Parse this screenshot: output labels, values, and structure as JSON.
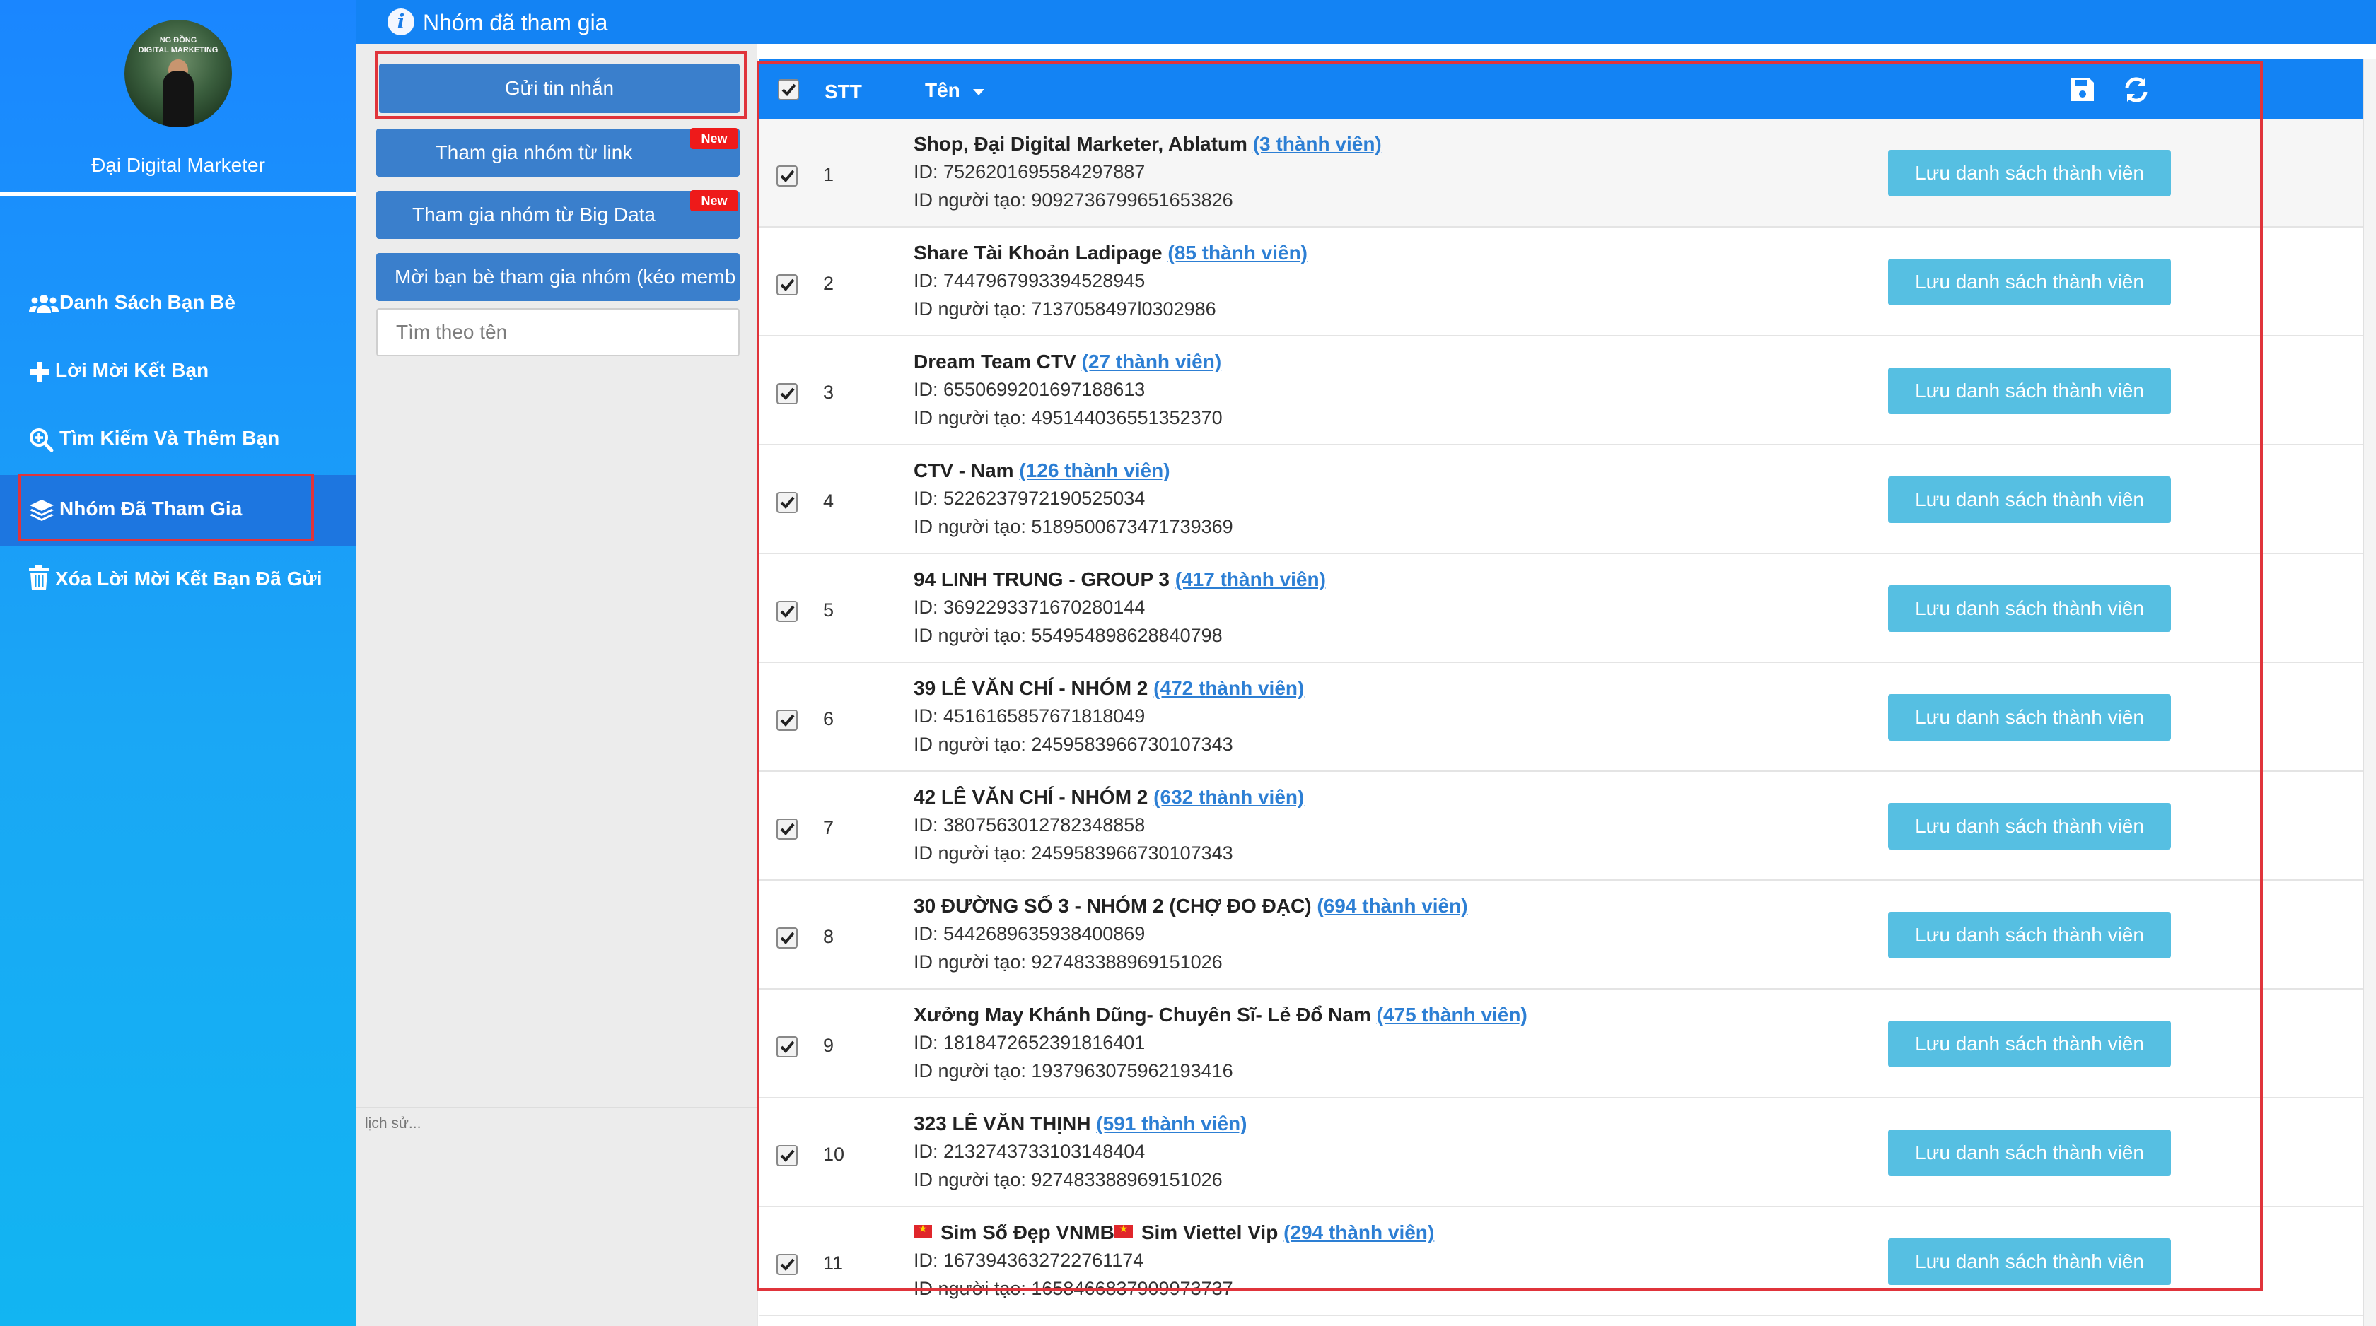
{
  "sidebar": {
    "profile_name": "Đại Digital Marketer",
    "avatar_banner": "NG ĐỒNG\nDIGITAL MARKETING",
    "nav": [
      {
        "label": "Danh Sách Bạn Bè",
        "icon": "users-icon"
      },
      {
        "label": "Lời Mời Kết Bạn",
        "icon": "plus-icon"
      },
      {
        "label": "Tìm Kiếm Và Thêm Bạn",
        "icon": "search-plus-icon"
      },
      {
        "label": "Nhóm Đã Tham Gia",
        "icon": "layers-icon",
        "active": true
      },
      {
        "label": "Xóa Lời Mời Kết Bạn Đã Gửi",
        "icon": "trash-icon"
      }
    ]
  },
  "header": {
    "title": "Nhóm đã tham gia",
    "icon": "info-icon"
  },
  "panel": {
    "send_message": "Gửi tin nhắn",
    "join_from_link": "Tham gia nhóm từ link",
    "join_from_bigdata": "Tham gia nhóm từ Big Data",
    "new_badge": "New",
    "invite_friends": "Mời bạn bè tham gia nhóm (kéo memb",
    "search_placeholder": "Tìm theo tên",
    "history": "lịch sử..."
  },
  "table": {
    "col_stt": "STT",
    "col_name": "Tên",
    "id_prefix": "ID: ",
    "creator_prefix": "ID người tạo: ",
    "save_members_label": "Lưu danh sách thành viên",
    "colors": {
      "header": "#1383f4",
      "save_button": "#56bfe2",
      "link": "#2d7fd4"
    },
    "rows": [
      {
        "stt": "1",
        "name": "Shop, Đại Digital Marketer, Ablatum",
        "members": "(3 thành viên)",
        "id": "7526201695584297887",
        "creator_id": "9092736799651653826"
      },
      {
        "stt": "2",
        "name": "Share Tài Khoản Ladipage",
        "members": "(85 thành viên)",
        "id": "7447967993394528945",
        "creator_id": "7137058497l0302986"
      },
      {
        "stt": "3",
        "name": "Dream Team CTV",
        "members": "(27 thành viên)",
        "id": "6550699201697188613",
        "creator_id": "4951440365513523​70"
      },
      {
        "stt": "4",
        "name": "CTV - Nam",
        "members": "(126 thành viên)",
        "id": "5226237972190525034",
        "creator_id": "5189500673471739369"
      },
      {
        "stt": "5",
        "name": "94 LINH TRUNG - GROUP 3",
        "members": "(417 thành viên)",
        "id": "3692293371670280144",
        "creator_id": "554954898628840798"
      },
      {
        "stt": "6",
        "name": "39 LÊ VĂN CHÍ - NHÓM 2",
        "members": "(472 thành viên)",
        "id": "4516165857671818049",
        "creator_id": "2459583966730107343"
      },
      {
        "stt": "7",
        "name": "42 LÊ VĂN CHÍ - NHÓM 2",
        "members": "(632 thành viên)",
        "id": "3807563012782348858",
        "creator_id": "2459583966730107343"
      },
      {
        "stt": "8",
        "name": "30 ĐƯỜNG SỐ 3 - NHÓM 2 (CHỢ ĐO ĐẠC)",
        "members": "(694 thành viên)",
        "id": "5442689635938400869",
        "creator_id": "9274833889691510​26"
      },
      {
        "stt": "9",
        "name": "Xưởng May Khánh Dũng- Chuyên Sĩ- Lẻ Đổ Nam",
        "members": "(475 thành viên)",
        "id": "1818472652391816401",
        "creator_id": "1937963075962193416"
      },
      {
        "stt": "10",
        "name": "323 LÊ VĂN THỊNH",
        "members": "(591 thành viên)",
        "id": "2132743733103148404",
        "creator_id": "9274833889691510​26"
      },
      {
        "stt": "11",
        "name": "Sim Số Đẹp VNMB",
        "name_suffix": "Sim Viettel Vip",
        "members": "(294 thành viên)",
        "id": "1673943632722761174",
        "creator_id": "1658466837909973737"
      }
    ]
  }
}
